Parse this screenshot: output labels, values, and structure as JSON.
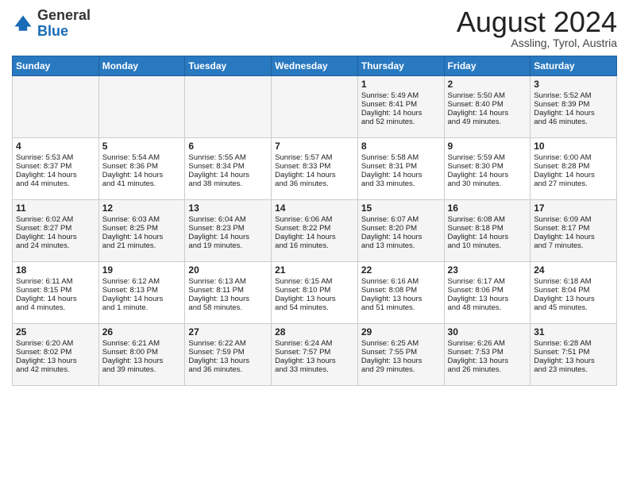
{
  "logo": {
    "general": "General",
    "blue": "Blue"
  },
  "header": {
    "month": "August 2024",
    "location": "Assling, Tyrol, Austria"
  },
  "days_of_week": [
    "Sunday",
    "Monday",
    "Tuesday",
    "Wednesday",
    "Thursday",
    "Friday",
    "Saturday"
  ],
  "weeks": [
    [
      {
        "day": "",
        "info": ""
      },
      {
        "day": "",
        "info": ""
      },
      {
        "day": "",
        "info": ""
      },
      {
        "day": "",
        "info": ""
      },
      {
        "day": "1",
        "info": "Sunrise: 5:49 AM\nSunset: 8:41 PM\nDaylight: 14 hours\nand 52 minutes."
      },
      {
        "day": "2",
        "info": "Sunrise: 5:50 AM\nSunset: 8:40 PM\nDaylight: 14 hours\nand 49 minutes."
      },
      {
        "day": "3",
        "info": "Sunrise: 5:52 AM\nSunset: 8:39 PM\nDaylight: 14 hours\nand 46 minutes."
      }
    ],
    [
      {
        "day": "4",
        "info": "Sunrise: 5:53 AM\nSunset: 8:37 PM\nDaylight: 14 hours\nand 44 minutes."
      },
      {
        "day": "5",
        "info": "Sunrise: 5:54 AM\nSunset: 8:36 PM\nDaylight: 14 hours\nand 41 minutes."
      },
      {
        "day": "6",
        "info": "Sunrise: 5:55 AM\nSunset: 8:34 PM\nDaylight: 14 hours\nand 38 minutes."
      },
      {
        "day": "7",
        "info": "Sunrise: 5:57 AM\nSunset: 8:33 PM\nDaylight: 14 hours\nand 36 minutes."
      },
      {
        "day": "8",
        "info": "Sunrise: 5:58 AM\nSunset: 8:31 PM\nDaylight: 14 hours\nand 33 minutes."
      },
      {
        "day": "9",
        "info": "Sunrise: 5:59 AM\nSunset: 8:30 PM\nDaylight: 14 hours\nand 30 minutes."
      },
      {
        "day": "10",
        "info": "Sunrise: 6:00 AM\nSunset: 8:28 PM\nDaylight: 14 hours\nand 27 minutes."
      }
    ],
    [
      {
        "day": "11",
        "info": "Sunrise: 6:02 AM\nSunset: 8:27 PM\nDaylight: 14 hours\nand 24 minutes."
      },
      {
        "day": "12",
        "info": "Sunrise: 6:03 AM\nSunset: 8:25 PM\nDaylight: 14 hours\nand 21 minutes."
      },
      {
        "day": "13",
        "info": "Sunrise: 6:04 AM\nSunset: 8:23 PM\nDaylight: 14 hours\nand 19 minutes."
      },
      {
        "day": "14",
        "info": "Sunrise: 6:06 AM\nSunset: 8:22 PM\nDaylight: 14 hours\nand 16 minutes."
      },
      {
        "day": "15",
        "info": "Sunrise: 6:07 AM\nSunset: 8:20 PM\nDaylight: 14 hours\nand 13 minutes."
      },
      {
        "day": "16",
        "info": "Sunrise: 6:08 AM\nSunset: 8:18 PM\nDaylight: 14 hours\nand 10 minutes."
      },
      {
        "day": "17",
        "info": "Sunrise: 6:09 AM\nSunset: 8:17 PM\nDaylight: 14 hours\nand 7 minutes."
      }
    ],
    [
      {
        "day": "18",
        "info": "Sunrise: 6:11 AM\nSunset: 8:15 PM\nDaylight: 14 hours\nand 4 minutes."
      },
      {
        "day": "19",
        "info": "Sunrise: 6:12 AM\nSunset: 8:13 PM\nDaylight: 14 hours\nand 1 minute."
      },
      {
        "day": "20",
        "info": "Sunrise: 6:13 AM\nSunset: 8:11 PM\nDaylight: 13 hours\nand 58 minutes."
      },
      {
        "day": "21",
        "info": "Sunrise: 6:15 AM\nSunset: 8:10 PM\nDaylight: 13 hours\nand 54 minutes."
      },
      {
        "day": "22",
        "info": "Sunrise: 6:16 AM\nSunset: 8:08 PM\nDaylight: 13 hours\nand 51 minutes."
      },
      {
        "day": "23",
        "info": "Sunrise: 6:17 AM\nSunset: 8:06 PM\nDaylight: 13 hours\nand 48 minutes."
      },
      {
        "day": "24",
        "info": "Sunrise: 6:18 AM\nSunset: 8:04 PM\nDaylight: 13 hours\nand 45 minutes."
      }
    ],
    [
      {
        "day": "25",
        "info": "Sunrise: 6:20 AM\nSunset: 8:02 PM\nDaylight: 13 hours\nand 42 minutes."
      },
      {
        "day": "26",
        "info": "Sunrise: 6:21 AM\nSunset: 8:00 PM\nDaylight: 13 hours\nand 39 minutes."
      },
      {
        "day": "27",
        "info": "Sunrise: 6:22 AM\nSunset: 7:59 PM\nDaylight: 13 hours\nand 36 minutes."
      },
      {
        "day": "28",
        "info": "Sunrise: 6:24 AM\nSunset: 7:57 PM\nDaylight: 13 hours\nand 33 minutes."
      },
      {
        "day": "29",
        "info": "Sunrise: 6:25 AM\nSunset: 7:55 PM\nDaylight: 13 hours\nand 29 minutes."
      },
      {
        "day": "30",
        "info": "Sunrise: 6:26 AM\nSunset: 7:53 PM\nDaylight: 13 hours\nand 26 minutes."
      },
      {
        "day": "31",
        "info": "Sunrise: 6:28 AM\nSunset: 7:51 PM\nDaylight: 13 hours\nand 23 minutes."
      }
    ]
  ]
}
